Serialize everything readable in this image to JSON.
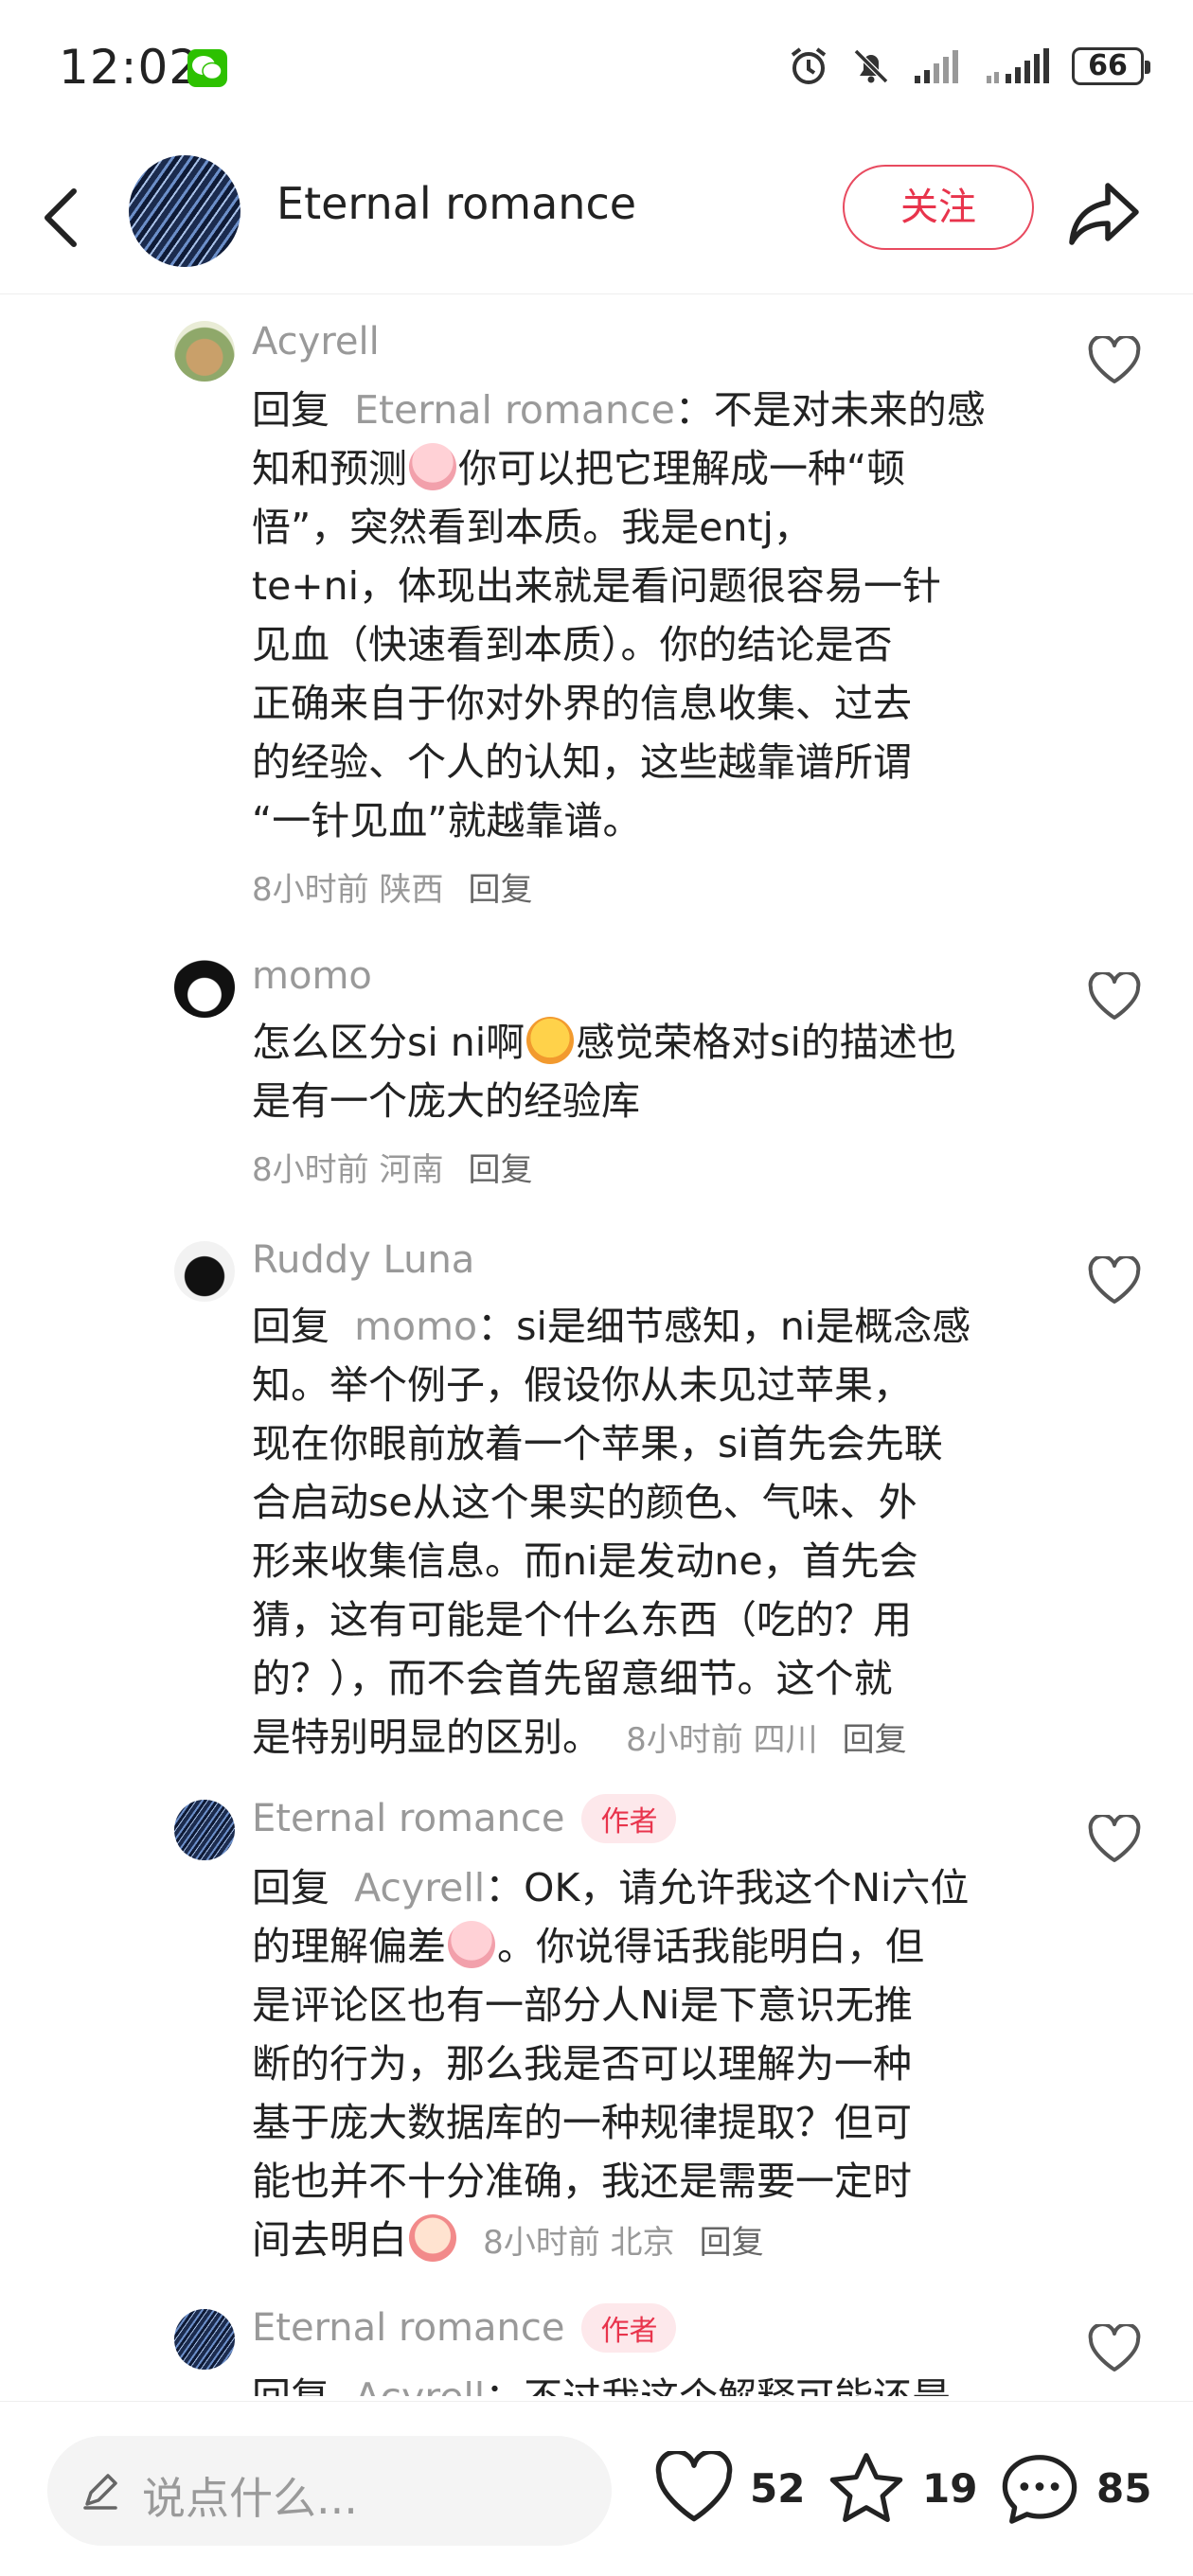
{
  "status_bar": {
    "time": "12:02",
    "battery": "66"
  },
  "header": {
    "title": "Eternal romance",
    "follow_label": "关注"
  },
  "comments": [
    {
      "name": "Acyrell",
      "reply_prefix": "回复",
      "reply_to": "Eternal romance",
      "text_1": "：不是对未来的感",
      "text_2": "知和预测",
      "text_3": "你可以把它理解成一种“顿",
      "text_4": "悟”，突然看到本质。我是entj，",
      "text_5": "te+ni，体现出来就是看问题很容易一针",
      "text_6": "见血（快速看到本质）。你的结论是否",
      "text_7": "正确来自于你对外界的信息收集、过去",
      "text_8": "的经验、个人的认知，这些越靠谱所谓",
      "text_9": "“一针见血”就越靠谱。",
      "meta": "8小时前 陕西",
      "reply_label": "回复"
    },
    {
      "name": "momo",
      "text_1": "怎么区分si ni啊",
      "text_2": "感觉荣格对si的描述也",
      "text_3": "是有一个庞大的经验库",
      "meta": "8小时前 河南",
      "reply_label": "回复"
    },
    {
      "name": "Ruddy Luna",
      "reply_prefix": "回复",
      "reply_to": "momo",
      "text_1": "：si是细节感知，ni是概念感",
      "text_2": "知。举个例子，假设你从未见过苹果，",
      "text_3": "现在你眼前放着一个苹果，si首先会先联",
      "text_4": "合启动se从这个果实的颜色、气味、外",
      "text_5": "形来收集信息。而ni是发动ne，首先会",
      "text_6": "猜，这有可能是个什么东西（吃的？用",
      "text_7": "的？），而不会首先留意细节。这个就",
      "text_8": "是特别明显的区别。",
      "meta": "8小时前 四川",
      "reply_label": "回复"
    },
    {
      "name": "Eternal romance",
      "tag": "作者",
      "reply_prefix": "回复",
      "reply_to": "Acyrell",
      "text_1": "：OK，请允许我这个Ni六位",
      "text_2": "的理解偏差",
      "text_3": "。你说得话我能明白，但",
      "text_4": "是评论区也有一部分人Ni是下意识无推",
      "text_5": "断的行为，那么我是否可以理解为一种",
      "text_6": "基于庞大数据库的一种规律提取？但可",
      "text_7": "能也并不十分准确，我还是需要一定时",
      "text_8": "间去明白",
      "meta": "8小时前 北京",
      "reply_label": "回复"
    },
    {
      "name": "Eternal romance",
      "tag": "作者",
      "reply_prefix": "回复",
      "reply_to": "Acyrell",
      "text_1": "：不过我这个解释可能还是"
    }
  ],
  "bottom_bar": {
    "placeholder": "说点什么...",
    "likes": "52",
    "favorites": "19",
    "comments": "85"
  }
}
